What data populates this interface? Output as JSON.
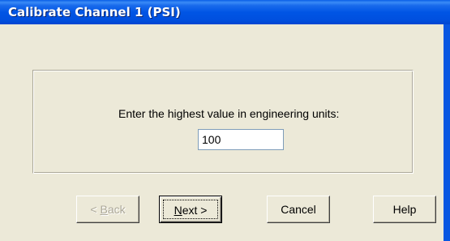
{
  "dialog": {
    "title": "Calibrate Channel 1 (PSI)"
  },
  "form": {
    "prompt": "Enter the highest value in engineering units:",
    "value": "100"
  },
  "buttons": {
    "back_mnemonic": "B",
    "back_pre": "< ",
    "back_post": "ack",
    "next_mnemonic": "N",
    "next_post": "ext >",
    "cancel": "Cancel",
    "help": "Help"
  },
  "colors": {
    "titlebar": "#0055e5",
    "face": "#ece9d8",
    "disabled_text": "#aca899"
  }
}
